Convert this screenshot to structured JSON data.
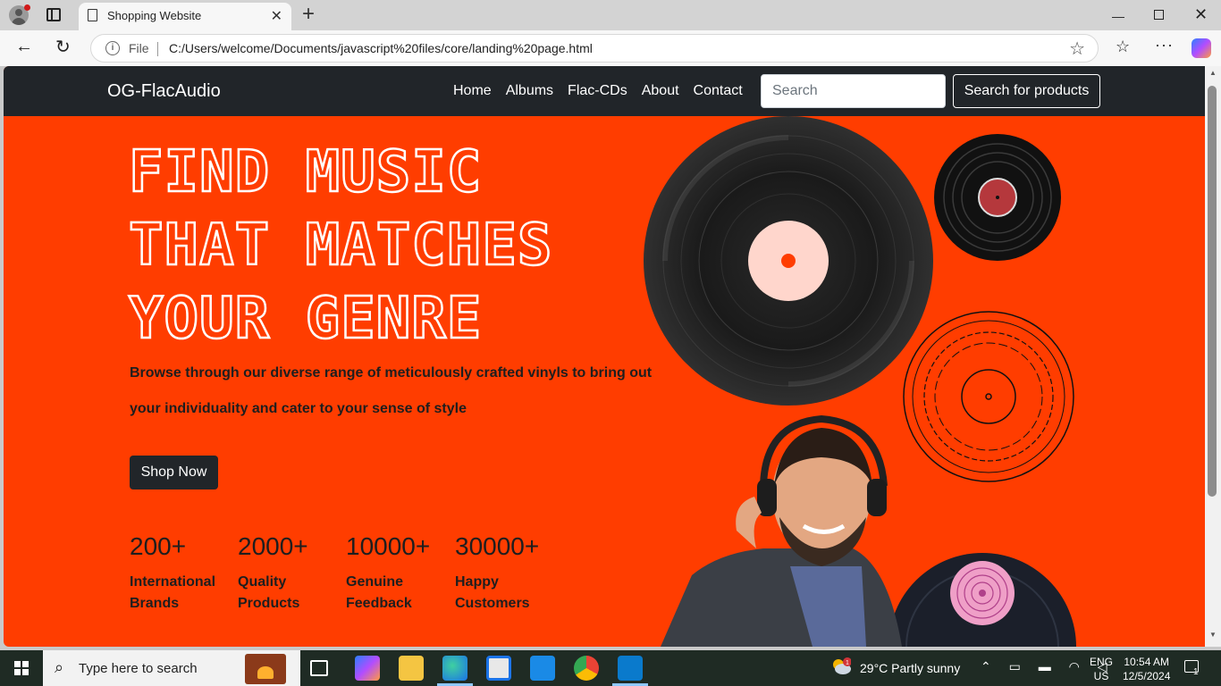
{
  "browser": {
    "tab_title": "Shopping Website",
    "address_prefix": "File",
    "url": "C:/Users/welcome/Documents/javascript%20files/core/landing%20page.html"
  },
  "site": {
    "brand": "OG-FlacAudio",
    "nav": [
      "Home",
      "Albums",
      "Flac-CDs",
      "About",
      "Contact"
    ],
    "search_placeholder": "Search",
    "search_button": "Search for products"
  },
  "hero": {
    "lines": [
      "FIND MUSIC",
      "THAT MATCHES",
      "YOUR GENRE"
    ],
    "subtitle_lines": [
      "Browse through our diverse range of meticulously crafted vinyls to bring out",
      "your individuality and cater to your sense of style"
    ],
    "cta": "Shop Now",
    "stats": [
      {
        "num": "200+",
        "label1": "International",
        "label2": "Brands"
      },
      {
        "num": "2000+",
        "label1": "Quality",
        "label2": "Products"
      },
      {
        "num": "10000+",
        "label1": "Genuine",
        "label2": "Feedback"
      },
      {
        "num": "30000+",
        "label1": "Happy",
        "label2": "Customers"
      }
    ]
  },
  "colors": {
    "hero_bg": "#ff3d00",
    "navbar": "#212529",
    "text_dark": "#1e1e1e"
  },
  "taskbar": {
    "search_text": "Type here to search",
    "weather": "29°C  Partly sunny",
    "lang1": "ENG",
    "lang2": "US",
    "time": "10:54 AM",
    "date": "12/5/2024",
    "notifications": "1",
    "weather_badge": "1"
  }
}
